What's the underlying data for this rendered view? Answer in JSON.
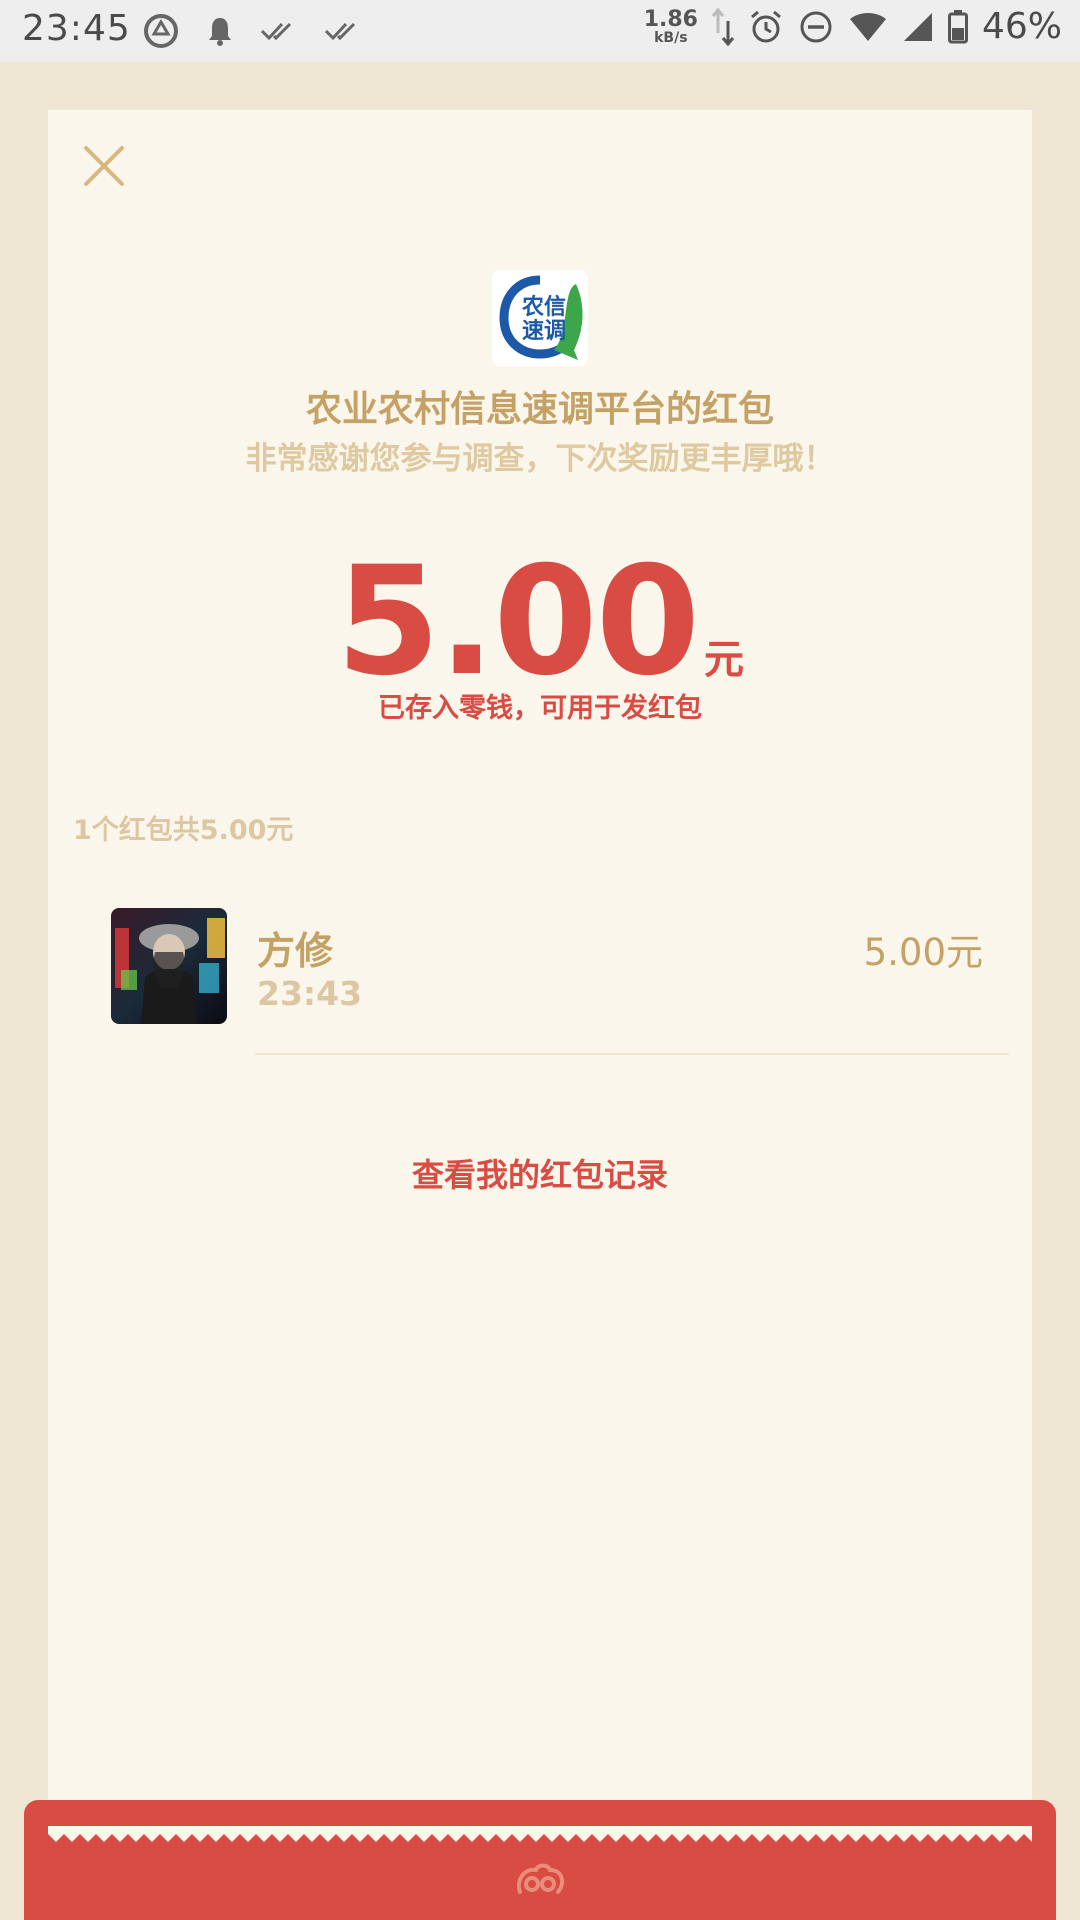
{
  "status_bar": {
    "time": "23:45",
    "net_speed_value": "1.86",
    "net_speed_unit": "kB/s",
    "battery_percent": "46%",
    "icons": [
      "sync-icon",
      "bell-icon",
      "double-check-icon",
      "double-check-icon",
      "data-arrows-icon",
      "alarm-icon",
      "do-not-disturb-icon",
      "wifi-icon",
      "signal-icon",
      "battery-icon"
    ]
  },
  "header": {
    "close_icon": "close-icon",
    "logo_icon": "nongxin-sudiao-logo",
    "title": "农业农村信息速调平台的红包",
    "subtitle": "非常感谢您参与调查，下次奖励更丰厚哦！"
  },
  "amount": {
    "value": "5.00",
    "unit": "元",
    "note": "已存入零钱，可用于发红包"
  },
  "summary": "1个红包共5.00元",
  "receivers": [
    {
      "name": "方修",
      "time": "23:43",
      "amount": "5.00元"
    }
  ],
  "record_link": "查看我的红包记录",
  "colors": {
    "accent_red": "#D84C43",
    "gold": "#C4A265",
    "light_gold": "#DCC7A2",
    "card_bg": "#FAF6EC",
    "page_bg": "#EEE5D3"
  }
}
